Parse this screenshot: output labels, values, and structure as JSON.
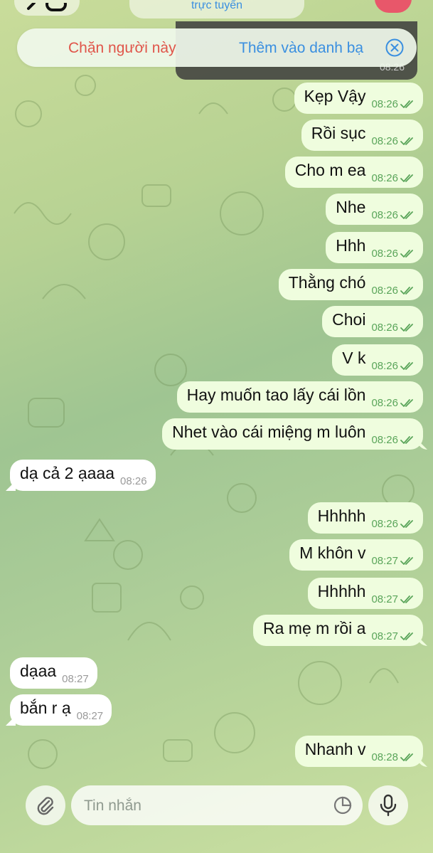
{
  "header": {
    "status": "trực tuyến"
  },
  "pinned": {
    "time": "08:26"
  },
  "action_bar": {
    "block_label": "Chặn người này",
    "add_contact_label": "Thêm vào danh bạ"
  },
  "messages": [
    {
      "dir": "out",
      "text": "Kẹp Vậy",
      "time": "08:26"
    },
    {
      "dir": "out",
      "text": "Rồi sục",
      "time": "08:26"
    },
    {
      "dir": "out",
      "text": "Cho m ea",
      "time": "08:26"
    },
    {
      "dir": "out",
      "text": "Nhe",
      "time": "08:26"
    },
    {
      "dir": "out",
      "text": "Hhh",
      "time": "08:26"
    },
    {
      "dir": "out",
      "text": "Thằng chó",
      "time": "08:26"
    },
    {
      "dir": "out",
      "text": "Choi",
      "time": "08:26"
    },
    {
      "dir": "out",
      "text": "V k",
      "time": "08:26"
    },
    {
      "dir": "out",
      "text": "Hay muốn tao lấy cái lồn",
      "time": "08:26"
    },
    {
      "dir": "out",
      "text": "Nhet vào cái miệng m luôn",
      "time": "08:26"
    },
    {
      "dir": "in",
      "text": "dạ cả 2 ạaaa",
      "time": "08:26"
    },
    {
      "dir": "out",
      "text": "Hhhhh",
      "time": "08:26"
    },
    {
      "dir": "out",
      "text": "M khôn v",
      "time": "08:27"
    },
    {
      "dir": "out",
      "text": "Hhhhh",
      "time": "08:27"
    },
    {
      "dir": "out",
      "text": "Ra mẹ m rồi a",
      "time": "08:27"
    },
    {
      "dir": "in",
      "text": "dạaa",
      "time": "08:27"
    },
    {
      "dir": "in",
      "text": "bắn r ạ",
      "time": "08:27"
    },
    {
      "dir": "out",
      "text": "Nhanh v",
      "time": "08:28"
    }
  ],
  "composer": {
    "placeholder": "Tin nhắn"
  },
  "colors": {
    "outgoing_bubble": "#effdde",
    "incoming_bubble": "#ffffff",
    "read_check": "#5aa55a",
    "block": "#e0554a",
    "link": "#3a8fe0"
  }
}
